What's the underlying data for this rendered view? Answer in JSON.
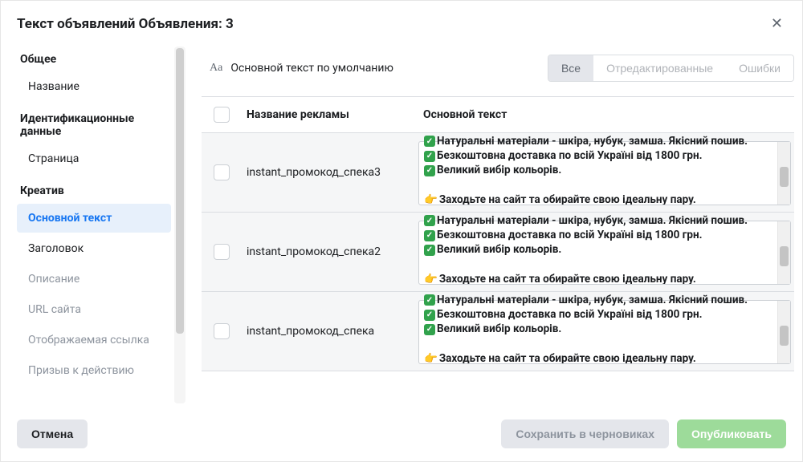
{
  "header": {
    "title": "Текст объявлений Объявления: 3"
  },
  "sidebar": {
    "sections": [
      {
        "head": "Общее",
        "items": [
          {
            "label": "Название",
            "muted": false
          }
        ]
      },
      {
        "head": "Идентификационные данные",
        "items": [
          {
            "label": "Страница",
            "muted": false
          }
        ]
      },
      {
        "head": "Креатив",
        "items": [
          {
            "label": "Основной текст",
            "active": true
          },
          {
            "label": "Заголовок",
            "muted": false
          },
          {
            "label": "Описание",
            "muted": true
          },
          {
            "label": "URL сайта",
            "muted": true
          },
          {
            "label": "Отображаемая ссылка",
            "muted": true
          },
          {
            "label": "Призыв к действию",
            "muted": true
          }
        ]
      }
    ]
  },
  "toolbar": {
    "label": "Основной текст по умолчанию",
    "filters": {
      "all": "Все",
      "edited": "Отредактированные",
      "errors": "Ошибки"
    }
  },
  "table": {
    "head": {
      "name": "Название рекламы",
      "text": "Основной текст"
    },
    "rows": [
      {
        "name": "instant_промокод_спека3"
      },
      {
        "name": "instant_промокод_спека2"
      },
      {
        "name": "instant_промокод_спека"
      }
    ],
    "body_lines": {
      "l1": "Натуральні матеріали - шкіра, нубук, замша. Якісний пошив.",
      "l2": "Безкоштовна доставка по всій Україні від 1800 грн.",
      "l3": "Великий вибір кольорів.",
      "l4": "Заходьте на сайт та обирайте свою ідеальну пару."
    }
  },
  "footer": {
    "cancel": "Отмена",
    "draft": "Сохранить в черновиках",
    "publish": "Опубликовать"
  }
}
